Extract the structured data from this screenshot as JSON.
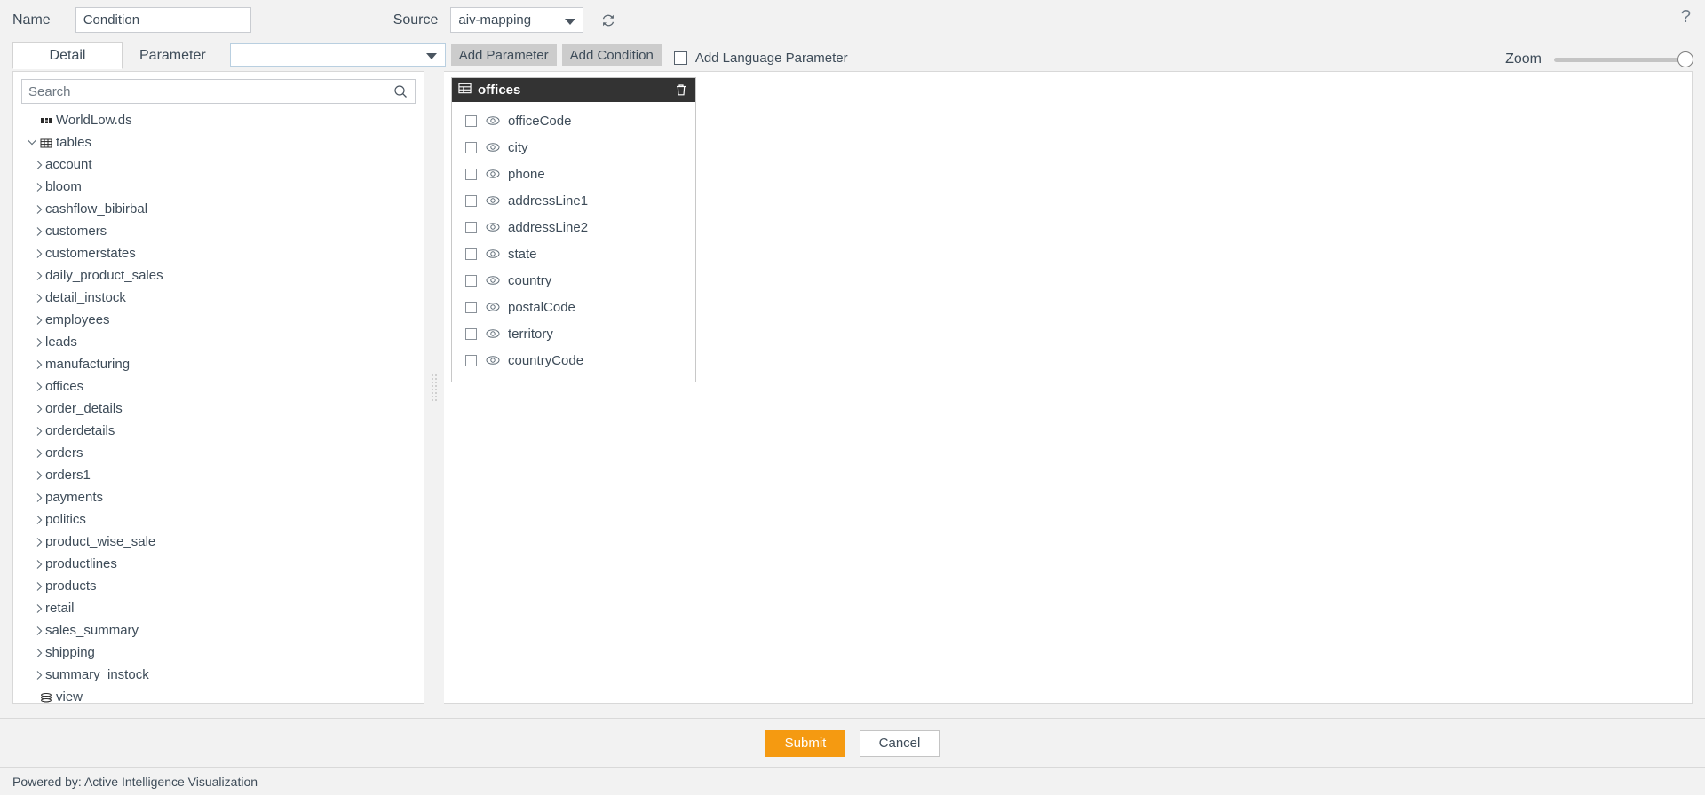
{
  "header": {
    "name_label": "Name",
    "name_value": "Condition",
    "source_label": "Source",
    "source_value": "aiv-mapping",
    "refresh_icon": "refresh-icon",
    "help_icon": "help-icon"
  },
  "toolbar": {
    "tabs": [
      {
        "label": "Detail",
        "active": true
      },
      {
        "label": "Parameter",
        "active": false
      }
    ],
    "parameter_select_value": "",
    "add_parameter_label": "Add Parameter",
    "add_condition_label": "Add Condition",
    "add_language_parameter_label": "Add Language Parameter",
    "add_language_parameter_checked": false,
    "zoom_label": "Zoom",
    "zoom_value": 100
  },
  "tree_panel": {
    "search_placeholder": "Search",
    "search_value": "",
    "search_icon": "search-icon",
    "nodes": [
      {
        "label": "WorldLow.ds",
        "level": 0,
        "icon": "datasource-icon",
        "arrow": ""
      },
      {
        "label": "tables",
        "level": 0,
        "icon": "tables-icon",
        "arrow": "expanded"
      },
      {
        "label": "account",
        "level": 1,
        "icon": "",
        "arrow": "collapsed"
      },
      {
        "label": "bloom",
        "level": 1,
        "icon": "",
        "arrow": "collapsed"
      },
      {
        "label": "cashflow_bibirbal",
        "level": 1,
        "icon": "",
        "arrow": "collapsed"
      },
      {
        "label": "customers",
        "level": 1,
        "icon": "",
        "arrow": "collapsed"
      },
      {
        "label": "customerstates",
        "level": 1,
        "icon": "",
        "arrow": "collapsed"
      },
      {
        "label": "daily_product_sales",
        "level": 1,
        "icon": "",
        "arrow": "collapsed"
      },
      {
        "label": "detail_instock",
        "level": 1,
        "icon": "",
        "arrow": "collapsed"
      },
      {
        "label": "employees",
        "level": 1,
        "icon": "",
        "arrow": "collapsed"
      },
      {
        "label": "leads",
        "level": 1,
        "icon": "",
        "arrow": "collapsed"
      },
      {
        "label": "manufacturing",
        "level": 1,
        "icon": "",
        "arrow": "collapsed"
      },
      {
        "label": "offices",
        "level": 1,
        "icon": "",
        "arrow": "collapsed"
      },
      {
        "label": "order_details",
        "level": 1,
        "icon": "",
        "arrow": "collapsed"
      },
      {
        "label": "orderdetails",
        "level": 1,
        "icon": "",
        "arrow": "collapsed"
      },
      {
        "label": "orders",
        "level": 1,
        "icon": "",
        "arrow": "collapsed"
      },
      {
        "label": "orders1",
        "level": 1,
        "icon": "",
        "arrow": "collapsed"
      },
      {
        "label": "payments",
        "level": 1,
        "icon": "",
        "arrow": "collapsed"
      },
      {
        "label": "politics",
        "level": 1,
        "icon": "",
        "arrow": "collapsed"
      },
      {
        "label": "product_wise_sale",
        "level": 1,
        "icon": "",
        "arrow": "collapsed"
      },
      {
        "label": "productlines",
        "level": 1,
        "icon": "",
        "arrow": "collapsed"
      },
      {
        "label": "products",
        "level": 1,
        "icon": "",
        "arrow": "collapsed"
      },
      {
        "label": "retail",
        "level": 1,
        "icon": "",
        "arrow": "collapsed"
      },
      {
        "label": "sales_summary",
        "level": 1,
        "icon": "",
        "arrow": "collapsed"
      },
      {
        "label": "shipping",
        "level": 1,
        "icon": "",
        "arrow": "collapsed"
      },
      {
        "label": "summary_instock",
        "level": 1,
        "icon": "",
        "arrow": "collapsed"
      },
      {
        "label": "view",
        "level": 0,
        "icon": "view-icon",
        "arrow": ""
      }
    ]
  },
  "canvas": {
    "table_card": {
      "title": "offices",
      "table_icon": "table-icon",
      "delete_icon": "trash-icon",
      "fields": [
        {
          "name": "officeCode",
          "checked": false,
          "visible_icon": "eye-icon"
        },
        {
          "name": "city",
          "checked": false,
          "visible_icon": "eye-icon"
        },
        {
          "name": "phone",
          "checked": false,
          "visible_icon": "eye-icon"
        },
        {
          "name": "addressLine1",
          "checked": false,
          "visible_icon": "eye-icon"
        },
        {
          "name": "addressLine2",
          "checked": false,
          "visible_icon": "eye-icon"
        },
        {
          "name": "state",
          "checked": false,
          "visible_icon": "eye-icon"
        },
        {
          "name": "country",
          "checked": false,
          "visible_icon": "eye-icon"
        },
        {
          "name": "postalCode",
          "checked": false,
          "visible_icon": "eye-icon"
        },
        {
          "name": "territory",
          "checked": false,
          "visible_icon": "eye-icon"
        },
        {
          "name": "countryCode",
          "checked": false,
          "visible_icon": "eye-icon"
        }
      ]
    }
  },
  "footer": {
    "submit_label": "Submit",
    "cancel_label": "Cancel"
  },
  "statusbar": {
    "text": "Powered by: Active Intelligence Visualization"
  },
  "colors": {
    "accent": "#f59a11",
    "card_header": "#333333",
    "page_bg": "#f2f2f2",
    "text": "#3e4c59"
  }
}
